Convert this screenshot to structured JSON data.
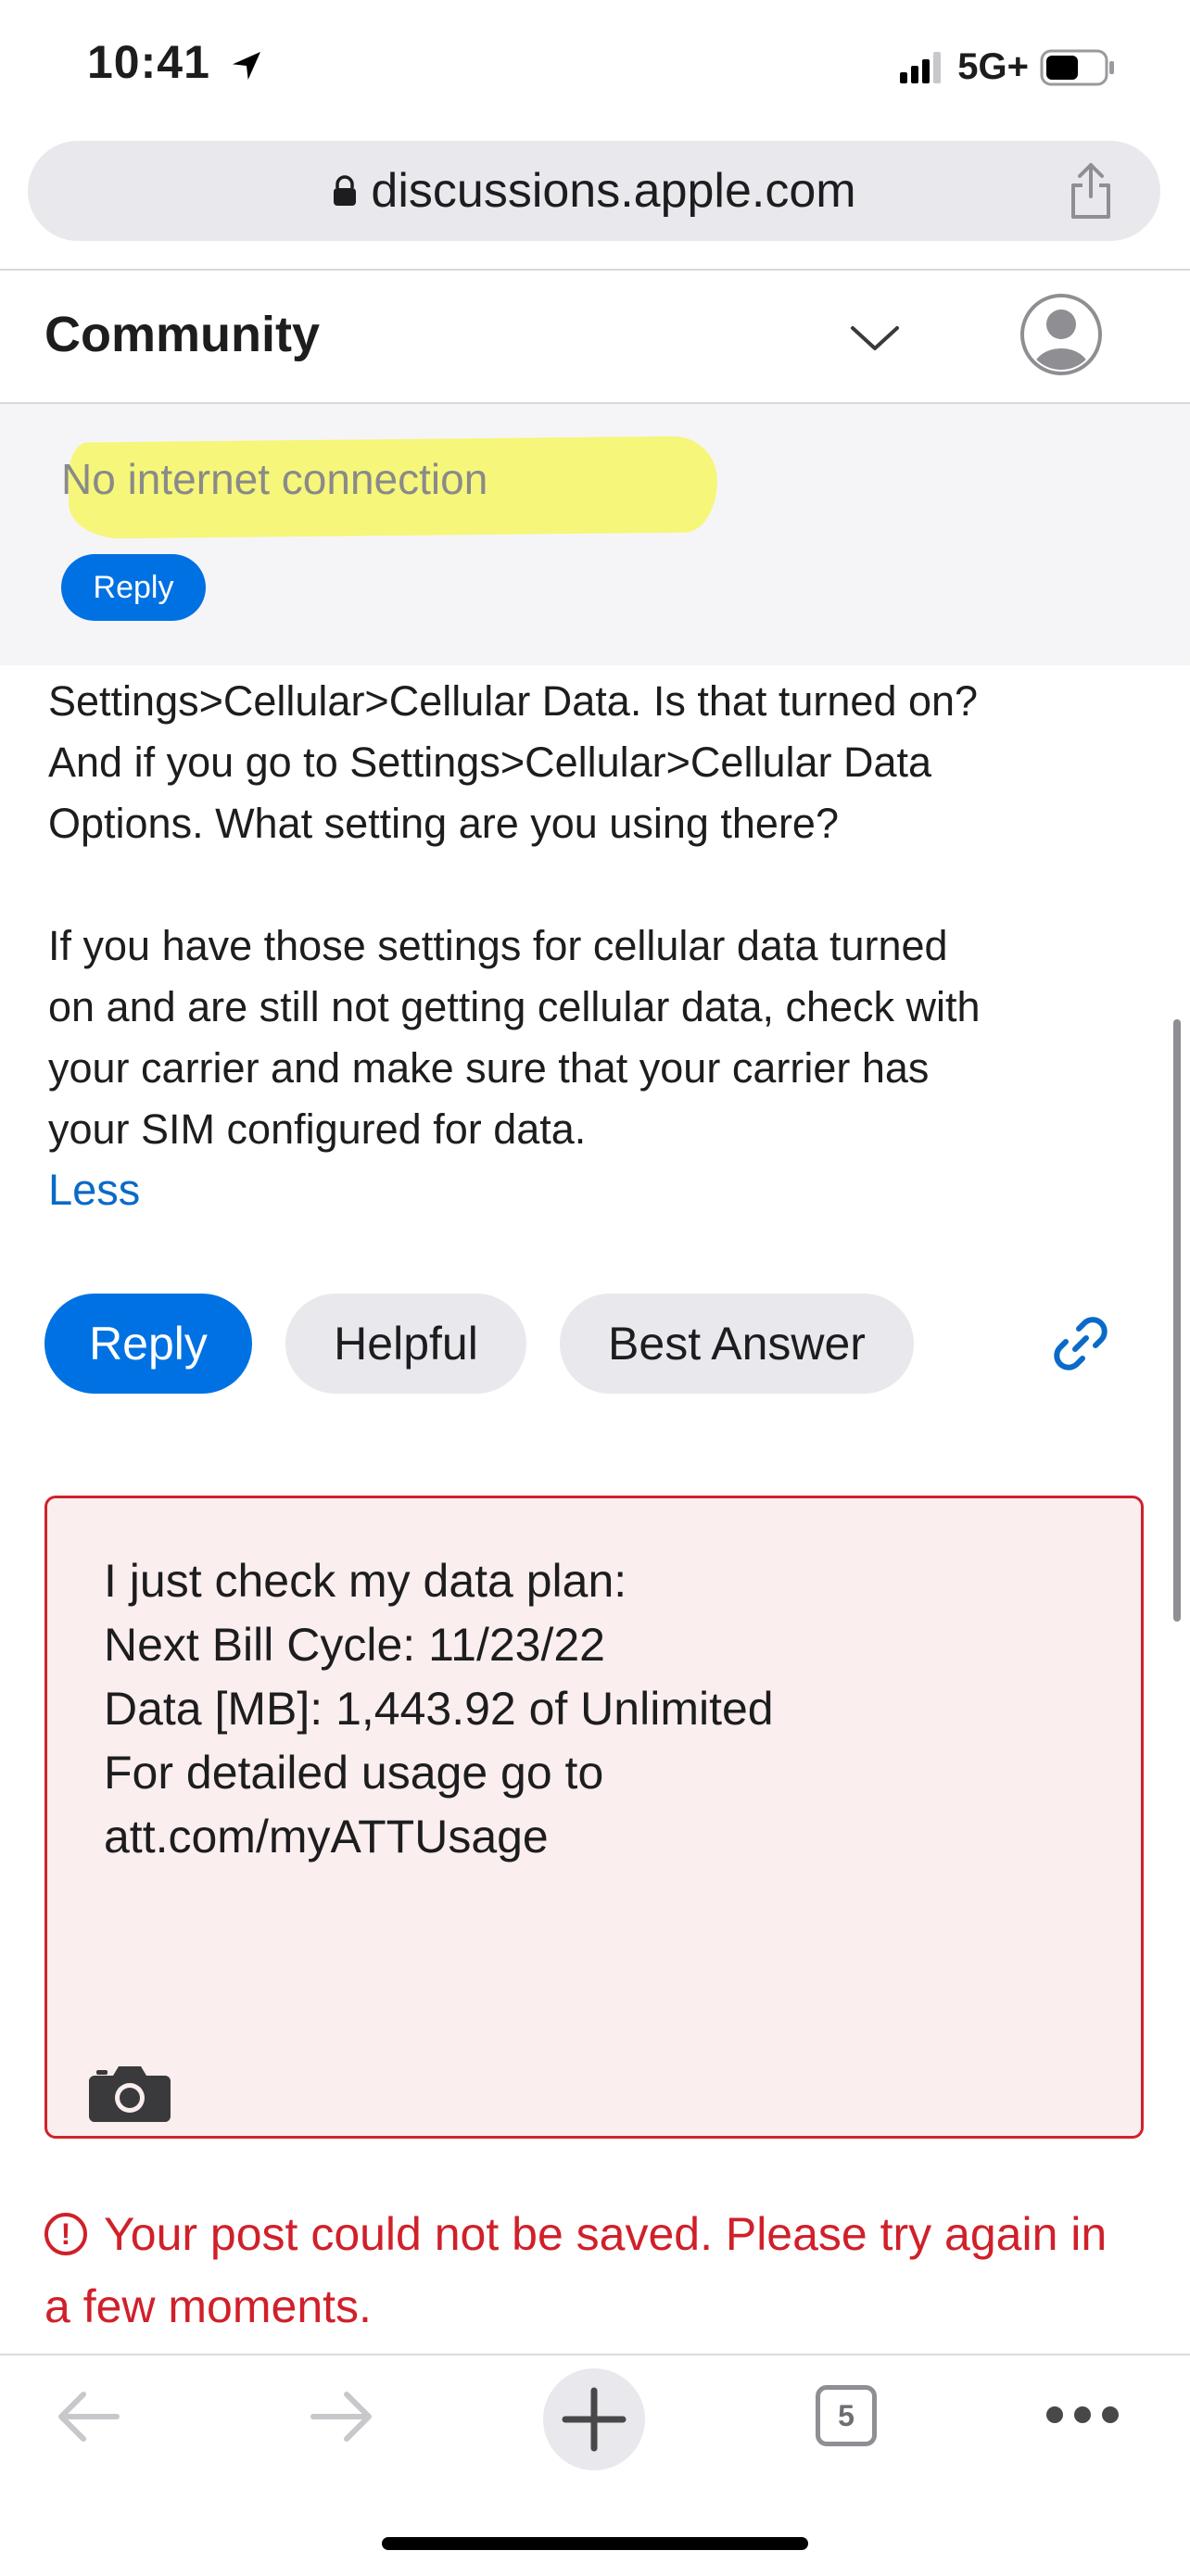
{
  "status_bar": {
    "time": "10:41",
    "network": "5G+"
  },
  "browser": {
    "url": "discussions.apple.com"
  },
  "header": {
    "title": "Community"
  },
  "banner": {
    "message": "No internet connection",
    "reply_label": "Reply"
  },
  "post": {
    "paragraphs": [
      "Settings>Cellular>Cellular Data. Is that turned on?",
      "And if you go to Settings>Cellular>Cellular Data",
      "Options. What setting are you using there?",
      "",
      "If you have those settings for cellular data turned",
      "on and are still not getting cellular data, check with",
      "your carrier and make sure that your carrier has",
      "your SIM configured for data."
    ],
    "less_label": "Less"
  },
  "actions": {
    "reply": "Reply",
    "helpful": "Helpful",
    "best_answer": "Best Answer"
  },
  "reply_box": {
    "lines": [
      "I just check my data plan:",
      "",
      "Next Bill Cycle: 11/23/22",
      "Data [MB]: 1,443.92 of Unlimited",
      "For detailed usage go to",
      "att.com/myATTUsage"
    ]
  },
  "error": {
    "message": "Your post could not be saved. Please try again in a few moments."
  },
  "toolbar": {
    "tab_count": "5"
  },
  "colors": {
    "accent": "#0071e3",
    "error": "#d0202a",
    "highlight": "#f6f67a"
  }
}
